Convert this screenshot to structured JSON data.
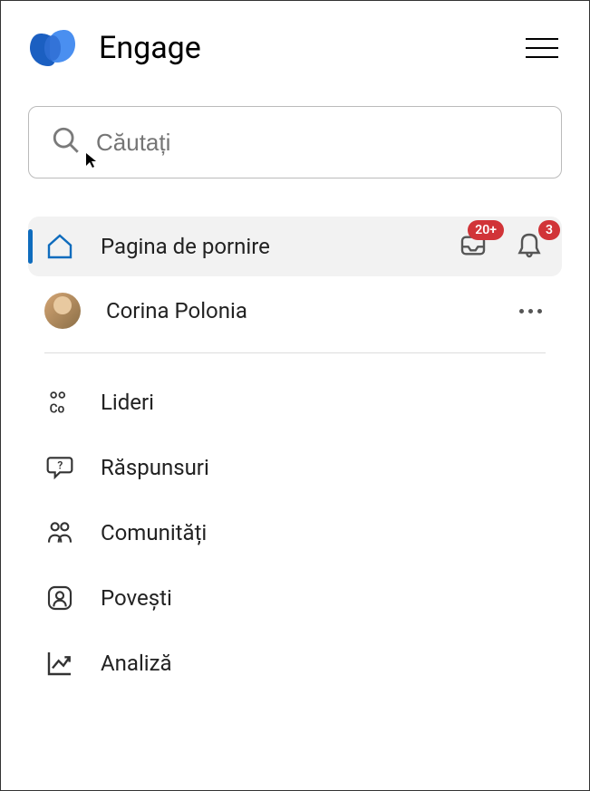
{
  "header": {
    "app_title": "Engage"
  },
  "search": {
    "placeholder": "Căutați"
  },
  "home": {
    "label": "Pagina de pornire",
    "inbox_badge": "20+",
    "bell_badge": "3"
  },
  "user": {
    "name": "Corina Polonia"
  },
  "nav": {
    "items": [
      {
        "label": "Lideri"
      },
      {
        "label": "Răspunsuri"
      },
      {
        "label": "Comunități"
      },
      {
        "label": "Povești"
      },
      {
        "label": "Analiză"
      }
    ]
  }
}
